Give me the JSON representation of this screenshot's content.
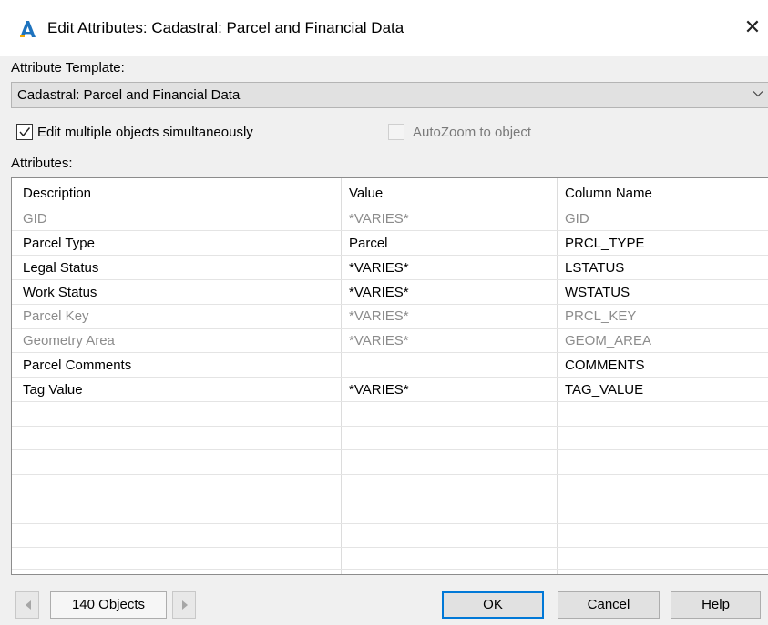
{
  "window": {
    "title": "Edit Attributes: Cadastral: Parcel and Financial Data",
    "close_glyph": "✕"
  },
  "template": {
    "label": "Attribute Template:",
    "selected": "Cadastral: Parcel and Financial Data"
  },
  "options": {
    "edit_multiple_label": "Edit multiple objects simultaneously",
    "edit_multiple_checked": true,
    "autozoom_label": "AutoZoom to object",
    "autozoom_checked": false,
    "autozoom_enabled": false
  },
  "attributes": {
    "label": "Attributes:",
    "columns": [
      "Description",
      "Value",
      "Column Name"
    ],
    "rows": [
      {
        "description": "GID",
        "value": "*VARIES*",
        "column": "GID",
        "editable": false
      },
      {
        "description": "Parcel Type",
        "value": "Parcel",
        "column": "PRCL_TYPE",
        "editable": true
      },
      {
        "description": "Legal Status",
        "value": "*VARIES*",
        "column": "LSTATUS",
        "editable": true
      },
      {
        "description": "Work Status",
        "value": "*VARIES*",
        "column": "WSTATUS",
        "editable": true
      },
      {
        "description": "Parcel Key",
        "value": "*VARIES*",
        "column": "PRCL_KEY",
        "editable": false
      },
      {
        "description": "Geometry Area",
        "value": "*VARIES*",
        "column": "GEOM_AREA",
        "editable": false
      },
      {
        "description": "Parcel Comments",
        "value": "",
        "column": "COMMENTS",
        "editable": true
      },
      {
        "description": "Tag Value",
        "value": "*VARIES*",
        "column": "TAG_VALUE",
        "editable": true
      }
    ]
  },
  "footer": {
    "object_count": "140 Objects",
    "ok_label": "OK",
    "cancel_label": "Cancel",
    "help_label": "Help"
  },
  "colors": {
    "accent": "#0078d7",
    "disabled_text": "#8c8c8c",
    "app_icon": "#1e73be"
  },
  "icons": {
    "app": "autocad-app-icon",
    "close": "close-icon",
    "dropdown": "chevron-down-icon",
    "prev": "triangle-left-icon",
    "next": "triangle-right-icon"
  }
}
